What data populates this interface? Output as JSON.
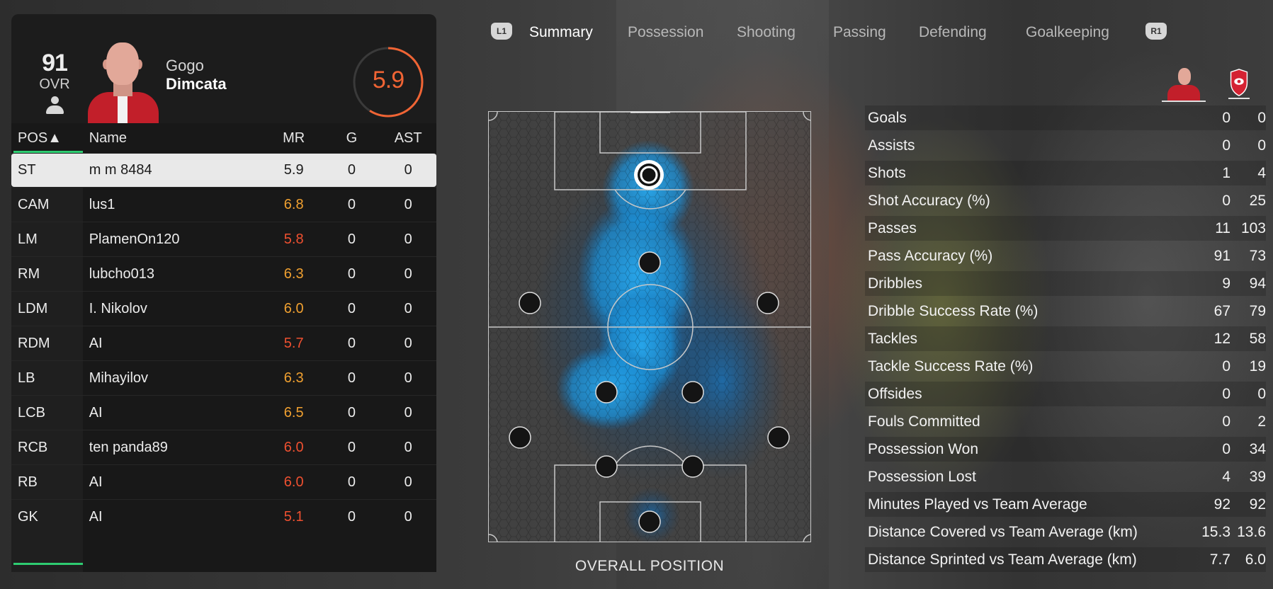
{
  "player": {
    "ovr_value": "91",
    "ovr_label": "OVR",
    "first_name": "Gogo",
    "last_name": "Dimcata",
    "match_rating": "5.9",
    "rating_fraction": 0.59
  },
  "table": {
    "headers": {
      "pos": "POS▲",
      "name": "Name",
      "mr": "MR",
      "g": "G",
      "ast": "AST"
    },
    "rows": [
      {
        "pos": "ST",
        "name": "m m 8484",
        "mr": "5.9",
        "g": "0",
        "ast": "0",
        "mr_color": "#1c1c1c"
      },
      {
        "pos": "CAM",
        "name": "lus1",
        "mr": "6.8",
        "g": "0",
        "ast": "0",
        "mr_color": "#f0a030"
      },
      {
        "pos": "LM",
        "name": "PlamenOn120",
        "mr": "5.8",
        "g": "0",
        "ast": "0",
        "mr_color": "#ee5030"
      },
      {
        "pos": "RM",
        "name": "lubcho013",
        "mr": "6.3",
        "g": "0",
        "ast": "0",
        "mr_color": "#f0a030"
      },
      {
        "pos": "LDM",
        "name": "I. Nikolov",
        "mr": "6.0",
        "g": "0",
        "ast": "0",
        "mr_color": "#f0a030"
      },
      {
        "pos": "RDM",
        "name": "AI",
        "mr": "5.7",
        "g": "0",
        "ast": "0",
        "mr_color": "#ee5030"
      },
      {
        "pos": "LB",
        "name": "Mihayilov",
        "mr": "6.3",
        "g": "0",
        "ast": "0",
        "mr_color": "#f0a030"
      },
      {
        "pos": "LCB",
        "name": "AI",
        "mr": "6.5",
        "g": "0",
        "ast": "0",
        "mr_color": "#f0a030"
      },
      {
        "pos": "RCB",
        "name": "ten panda89",
        "mr": "6.0",
        "g": "0",
        "ast": "0",
        "mr_color": "#ee5030"
      },
      {
        "pos": "RB",
        "name": "AI",
        "mr": "6.0",
        "g": "0",
        "ast": "0",
        "mr_color": "#ee5030"
      },
      {
        "pos": "GK",
        "name": "AI",
        "mr": "5.1",
        "g": "0",
        "ast": "0",
        "mr_color": "#ee5030"
      }
    ]
  },
  "tabs": {
    "left_button": "L1",
    "right_button": "R1",
    "items": [
      "Summary",
      "Possession",
      "Shooting",
      "Passing",
      "Defending",
      "Goalkeeping"
    ],
    "active": "Summary"
  },
  "pitch": {
    "label": "OVERALL POSITION"
  },
  "stats": [
    {
      "label": "Goals",
      "player": "0",
      "team": "0"
    },
    {
      "label": "Assists",
      "player": "0",
      "team": "0"
    },
    {
      "label": "Shots",
      "player": "1",
      "team": "4"
    },
    {
      "label": "Shot Accuracy (%)",
      "player": "0",
      "team": "25"
    },
    {
      "label": "Passes",
      "player": "11",
      "team": "103"
    },
    {
      "label": "Pass Accuracy (%)",
      "player": "91",
      "team": "73"
    },
    {
      "label": "Dribbles",
      "player": "9",
      "team": "94"
    },
    {
      "label": "Dribble Success Rate (%)",
      "player": "67",
      "team": "79"
    },
    {
      "label": "Tackles",
      "player": "12",
      "team": "58"
    },
    {
      "label": "Tackle Success Rate (%)",
      "player": "0",
      "team": "19"
    },
    {
      "label": "Offsides",
      "player": "0",
      "team": "0"
    },
    {
      "label": "Fouls Committed",
      "player": "0",
      "team": "2"
    },
    {
      "label": "Possession Won",
      "player": "0",
      "team": "34"
    },
    {
      "label": "Possession Lost",
      "player": "4",
      "team": "39"
    },
    {
      "label": "Minutes Played vs Team Average",
      "player": "92",
      "team": "92"
    },
    {
      "label": "Distance Covered vs Team Average (km)",
      "player": "15.3",
      "team": "13.6"
    },
    {
      "label": "Distance Sprinted vs Team Average (km)",
      "player": "7.7",
      "team": "6.0"
    }
  ],
  "colors": {
    "accent_green": "#2ecc71",
    "rating_orange": "#f06434",
    "heatmap_blue": "#1ea0e6"
  }
}
